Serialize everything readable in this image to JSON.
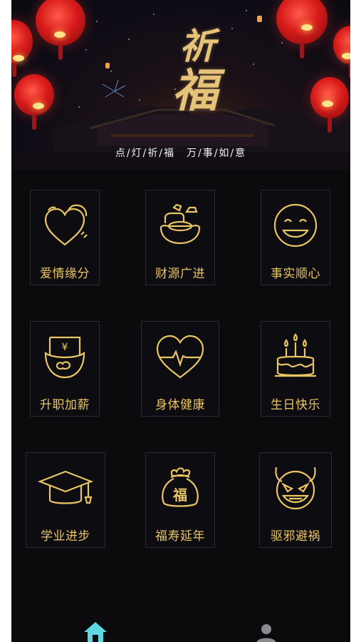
{
  "banner": {
    "title_chars": [
      "祈",
      "福"
    ],
    "subtitle": "点/灯/祈/福　万/事/如/意"
  },
  "accent_color": "#e9c565",
  "grid": [
    {
      "label": "爱情缘分",
      "icon": "hearts-icon"
    },
    {
      "label": "财源广进",
      "icon": "gold-ingot-icon"
    },
    {
      "label": "事实顺心",
      "icon": "smiley-icon"
    },
    {
      "label": "升职加薪",
      "icon": "money-envelope-icon"
    },
    {
      "label": "身体健康",
      "icon": "heart-pulse-icon"
    },
    {
      "label": "生日快乐",
      "icon": "birthday-cake-icon"
    },
    {
      "label": "学业进步",
      "icon": "graduation-cap-icon"
    },
    {
      "label": "福寿延年",
      "icon": "fortune-bag-icon"
    },
    {
      "label": "驱邪避祸",
      "icon": "devil-face-icon"
    }
  ],
  "tabbar": {
    "active_color": "#5fd6e0",
    "items": [
      {
        "icon": "home-icon",
        "active": true
      },
      {
        "icon": "user-icon",
        "active": false
      }
    ]
  }
}
